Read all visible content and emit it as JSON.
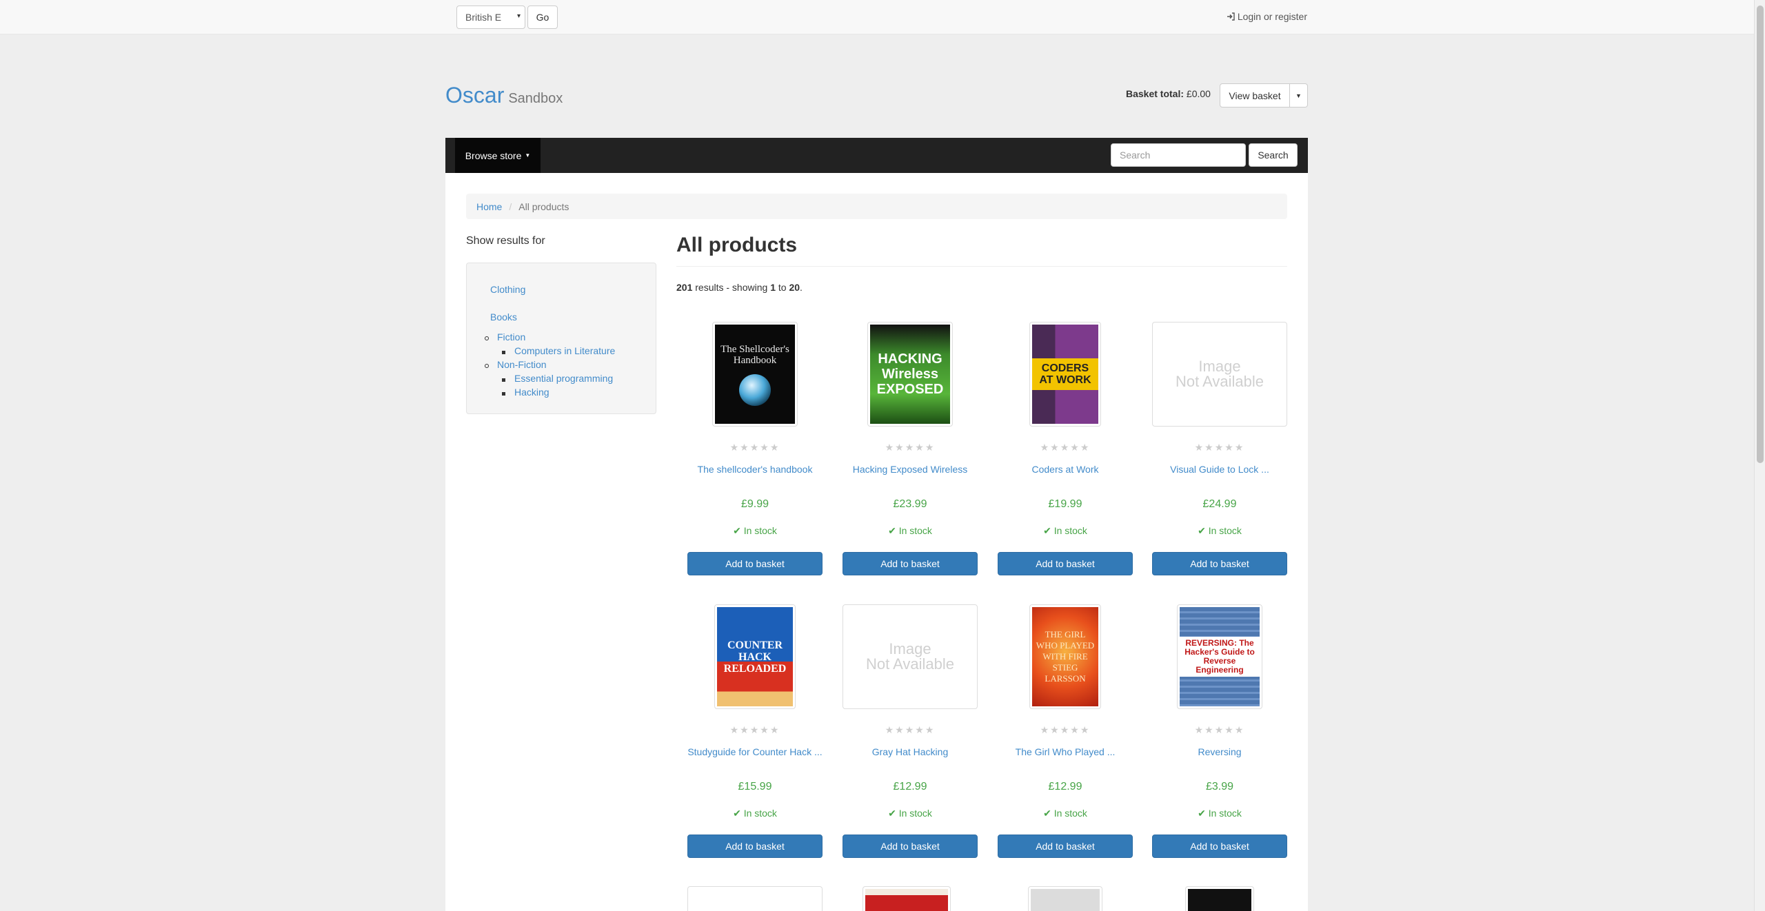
{
  "topbar": {
    "language_value": "British E",
    "go_label": "Go",
    "login_label": "Login or register"
  },
  "header": {
    "brand_name": "Oscar",
    "brand_sub": "Sandbox",
    "basket_total_label": "Basket total:",
    "basket_total_value": "£0.00",
    "view_basket_label": "View basket"
  },
  "navbar": {
    "browse_label": "Browse store",
    "search_placeholder": "Search",
    "search_button": "Search"
  },
  "breadcrumb": {
    "home": "Home",
    "current": "All products"
  },
  "sidebar": {
    "heading": "Show results for",
    "categories": {
      "clothing": "Clothing",
      "books": "Books",
      "fiction": "Fiction",
      "computers_in_literature": "Computers in Literature",
      "non_fiction": "Non-Fiction",
      "essential_programming": "Essential programming",
      "hacking": "Hacking"
    }
  },
  "main": {
    "title": "All products",
    "results_total": "201",
    "results_text_1": " results - showing ",
    "results_from": "1",
    "results_text_2": " to ",
    "results_to": "20",
    "results_text_3": "."
  },
  "product_common": {
    "stock_label": "In stock",
    "add_label": "Add to basket",
    "image_na_line1": "Image",
    "image_na_line2": "Not Available",
    "rating_stars": 0
  },
  "products": [
    {
      "title": "The shellcoder's handbook",
      "price": "£9.99",
      "cover_text": "The Shellcoder's Handbook"
    },
    {
      "title": "Hacking Exposed Wireless",
      "price": "£23.99",
      "cover_text": "HACKING Wireless EXPOSED"
    },
    {
      "title": "Coders at Work",
      "price": "£19.99",
      "cover_text": "CODERS AT WORK"
    },
    {
      "title": "Visual Guide to Lock ...",
      "price": "£24.99",
      "cover_text": ""
    },
    {
      "title": "Studyguide for Counter Hack ...",
      "price": "£15.99",
      "cover_text": "COUNTER HACK RELOADED"
    },
    {
      "title": "Gray Hat Hacking",
      "price": "£12.99",
      "cover_text": ""
    },
    {
      "title": "The Girl Who Played ...",
      "price": "£12.99",
      "cover_text": "THE GIRL WHO PLAYED WITH FIRE STIEG LARSSON"
    },
    {
      "title": "Reversing",
      "price": "£3.99",
      "cover_text": "REVERSING: The Hacker's Guide to Reverse Engineering"
    }
  ],
  "colors": {
    "link": "#428bca",
    "price_green": "#47a447",
    "button_blue": "#337ab7",
    "navbar": "#222222"
  }
}
